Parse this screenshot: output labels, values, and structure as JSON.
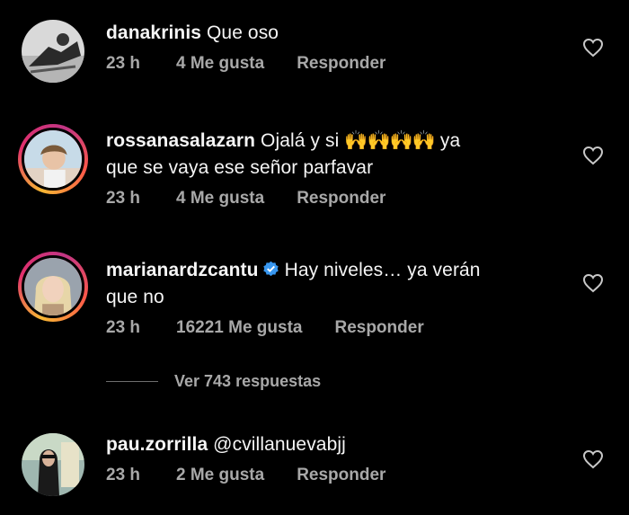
{
  "comments": [
    {
      "username": "danakrinis",
      "text": "Que oso",
      "time": "23 h",
      "likes": "4 Me gusta",
      "reply_label": "Responder",
      "avatar_icon": "profile-photo",
      "story_ring": false
    },
    {
      "username": "rossanasalazarn",
      "text_part1": "Ojalá y si",
      "emoji": "🙌🙌🙌🙌",
      "text_part2": "ya",
      "text_line2": "que se vaya ese señor parfavar",
      "time": "23 h",
      "likes": "4 Me gusta",
      "reply_label": "Responder",
      "avatar_icon": "profile-photo",
      "story_ring": true
    },
    {
      "username": "marianardzcantu",
      "verified": true,
      "text_line1": "Hay niveles… ya verán",
      "text_line2": "que no",
      "time": "23 h",
      "likes": "16221 Me gusta",
      "reply_label": "Responder",
      "avatar_icon": "profile-photo",
      "story_ring": true
    },
    {
      "username": "pau.zorrilla",
      "text": "@cvillanuevabjj",
      "time": "23 h",
      "likes": "2 Me gusta",
      "reply_label": "Responder",
      "avatar_icon": "profile-photo",
      "story_ring": false
    }
  ],
  "view_replies_label": "Ver 743 respuestas",
  "colors": {
    "background": "#000000",
    "primary_text": "#f5f5f5",
    "secondary_text": "#a8a8a8",
    "verified_blue": "#3897f0",
    "emoji_yellow": "#f4b400"
  }
}
